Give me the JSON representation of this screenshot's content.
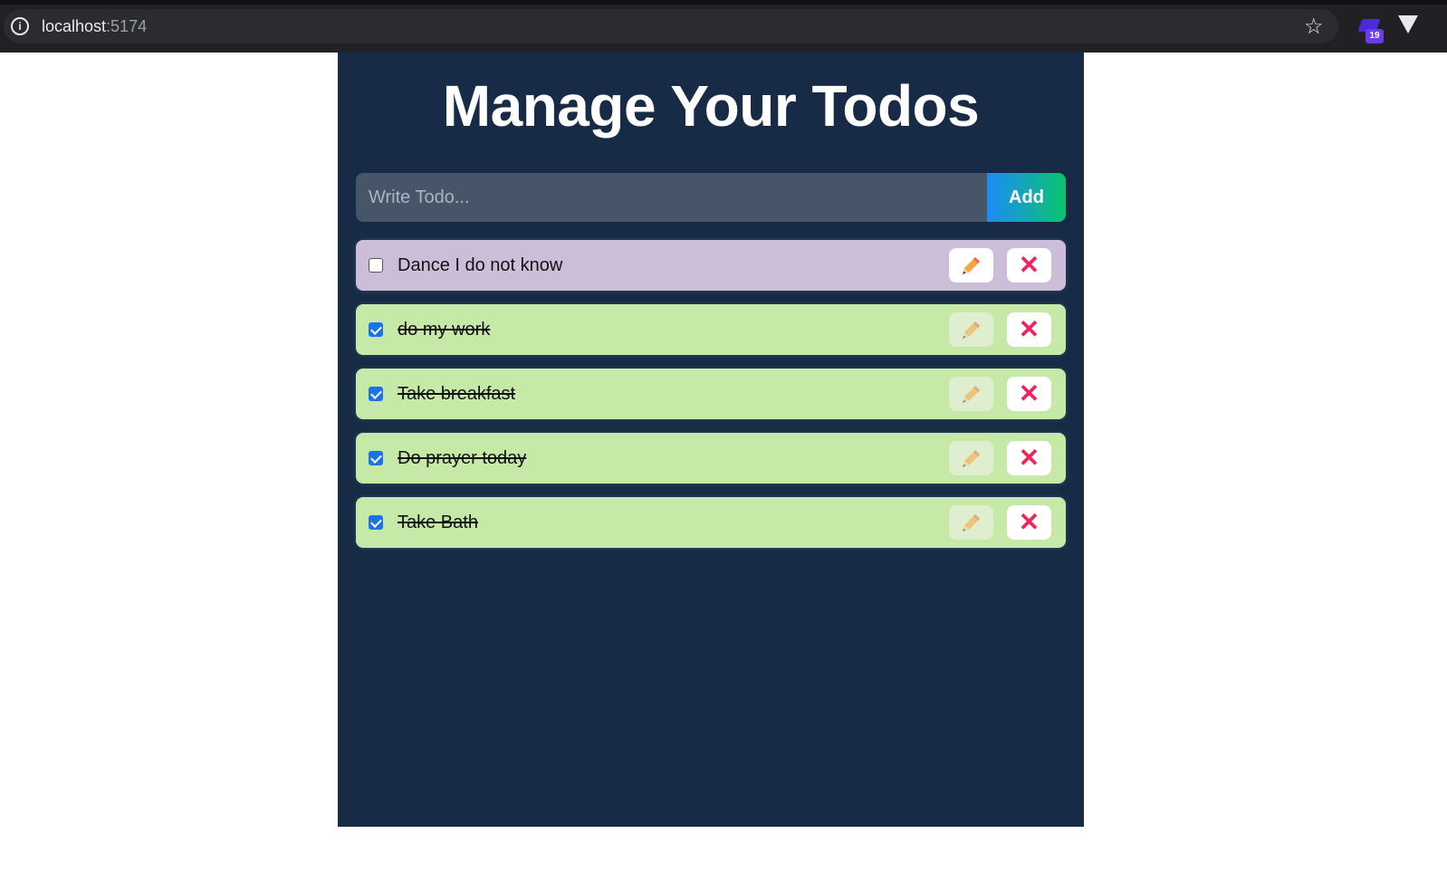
{
  "browser": {
    "url_host": "localhost",
    "url_port": ":5174",
    "extension_badge": "19"
  },
  "app": {
    "title": "Manage Your Todos",
    "input_placeholder": "Write Todo...",
    "input_value": "",
    "add_label": "Add",
    "todos": [
      {
        "text": "Dance I do not know",
        "completed": false
      },
      {
        "text": "do my work",
        "completed": true
      },
      {
        "text": "Take breakfast",
        "completed": true
      },
      {
        "text": "Do prayer today",
        "completed": true
      },
      {
        "text": "Take Bath",
        "completed": true
      }
    ]
  },
  "colors": {
    "panel_bg": "#172a46",
    "pending_bg": "#ccbed9",
    "done_bg": "#c6e9a7",
    "delete_accent": "#f0245a",
    "add_gradient_start": "#1d8cf8",
    "add_gradient_end": "#0ac46c"
  },
  "icons": {
    "edit": "pencil-icon",
    "delete": "close-icon"
  }
}
